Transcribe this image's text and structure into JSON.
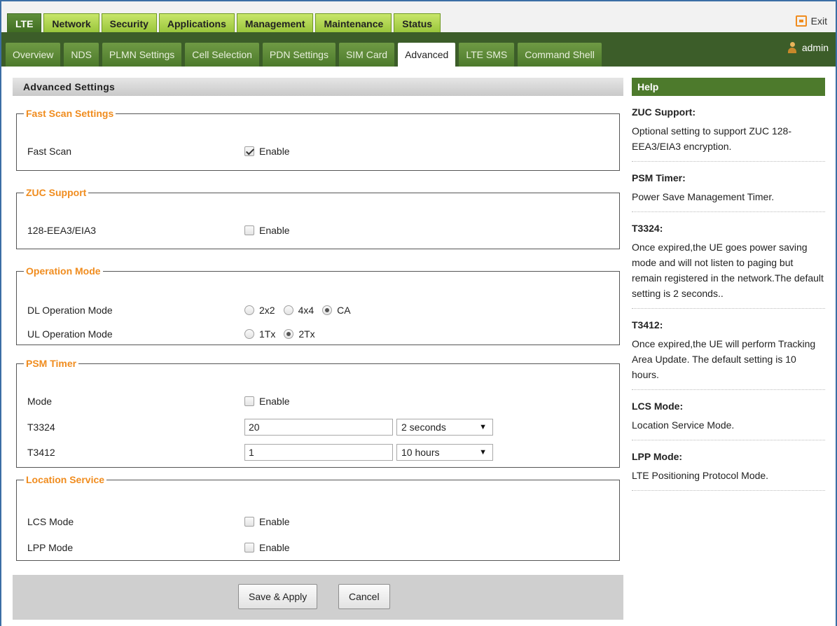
{
  "top_tabs": [
    "LTE",
    "Network",
    "Security",
    "Applications",
    "Management",
    "Maintenance",
    "Status"
  ],
  "exit_label": "Exit",
  "sub_tabs": [
    "Overview",
    "NDS",
    "PLMN Settings",
    "Cell Selection",
    "PDN Settings",
    "SIM Card",
    "Advanced",
    "LTE SMS",
    "Command Shell"
  ],
  "user": "admin",
  "page_title": "Advanced Settings",
  "help_title": "Help",
  "groups": {
    "fast_scan": {
      "legend": "Fast Scan Settings",
      "label": "Fast Scan",
      "enable": "Enable",
      "checked": true
    },
    "zuc": {
      "legend": "ZUC Support",
      "label": "128-EEA3/EIA3",
      "enable": "Enable",
      "checked": false
    },
    "op_mode": {
      "legend": "Operation Mode",
      "dl_label": "DL Operation Mode",
      "dl_options": [
        "2x2",
        "4x4",
        "CA"
      ],
      "dl_selected": "CA",
      "ul_label": "UL Operation Mode",
      "ul_options": [
        "1Tx",
        "2Tx"
      ],
      "ul_selected": "2Tx"
    },
    "psm": {
      "legend": "PSM Timer",
      "mode_label": "Mode",
      "enable": "Enable",
      "checked": false,
      "t3324_label": "T3324",
      "t3324_value": "20",
      "t3324_unit": "2 seconds",
      "t3412_label": "T3412",
      "t3412_value": "1",
      "t3412_unit": "10 hours"
    },
    "location": {
      "legend": "Location Service",
      "lcs_label": "LCS Mode",
      "lpp_label": "LPP Mode",
      "enable": "Enable"
    }
  },
  "buttons": {
    "save": "Save & Apply",
    "cancel": "Cancel"
  },
  "help": [
    {
      "title": "ZUC Support:",
      "text": "Optional setting to support ZUC 128-EEA3/EIA3 encryption."
    },
    {
      "title": "PSM Timer:",
      "text": "Power Save Management Timer."
    },
    {
      "title": "T3324:",
      "text": "Once expired,the UE goes power saving mode and will not listen to paging but remain registered in the network.The default setting is 2 seconds.."
    },
    {
      "title": "T3412:",
      "text": "Once expired,the UE will perform Tracking Area Update. The default setting is 10 hours."
    },
    {
      "title": "LCS Mode:",
      "text": "Location Service Mode."
    },
    {
      "title": "LPP Mode:",
      "text": "LTE Positioning Protocol Mode."
    }
  ]
}
